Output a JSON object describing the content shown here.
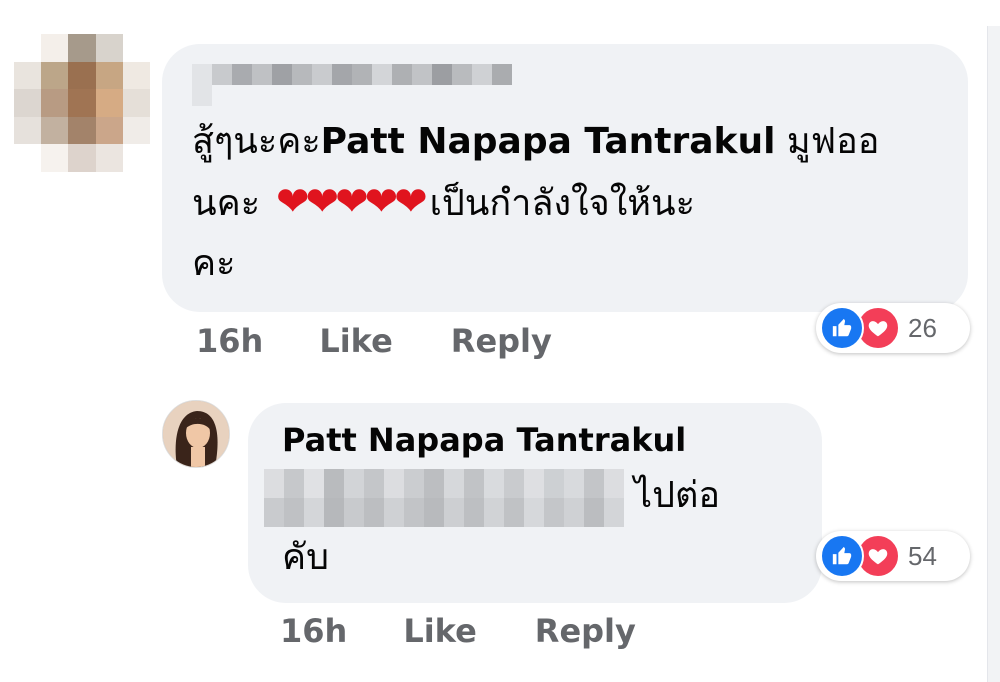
{
  "comment1": {
    "text_prefix": "สู้ๆนะคะ",
    "mentioned_name": "Patt Napapa Tantrakul",
    "text_suffix_line1": " มูฟออ",
    "text_line2_start": "นคะ",
    "hearts": "❤❤❤❤❤",
    "text_line2_end": "เป็นกำลังใจให้นะ",
    "text_line3": "คะ",
    "time": "16h",
    "like_label": "Like",
    "reply_label": "Reply",
    "reaction_count": "26"
  },
  "comment2": {
    "author_name": "Patt Napapa Tantrakul",
    "text_visible_end": "ไปต่อ",
    "text_line2": "คับ",
    "time": "16h",
    "like_label": "Like",
    "reply_label": "Reply",
    "reaction_count": "54"
  },
  "colors": {
    "bubble": "#f0f2f5",
    "like_blue": "#1877f2",
    "love_red": "#f33e58",
    "meta_gray": "#65676b"
  },
  "icons": {
    "like": "like-reaction-icon",
    "love": "love-reaction-icon"
  }
}
